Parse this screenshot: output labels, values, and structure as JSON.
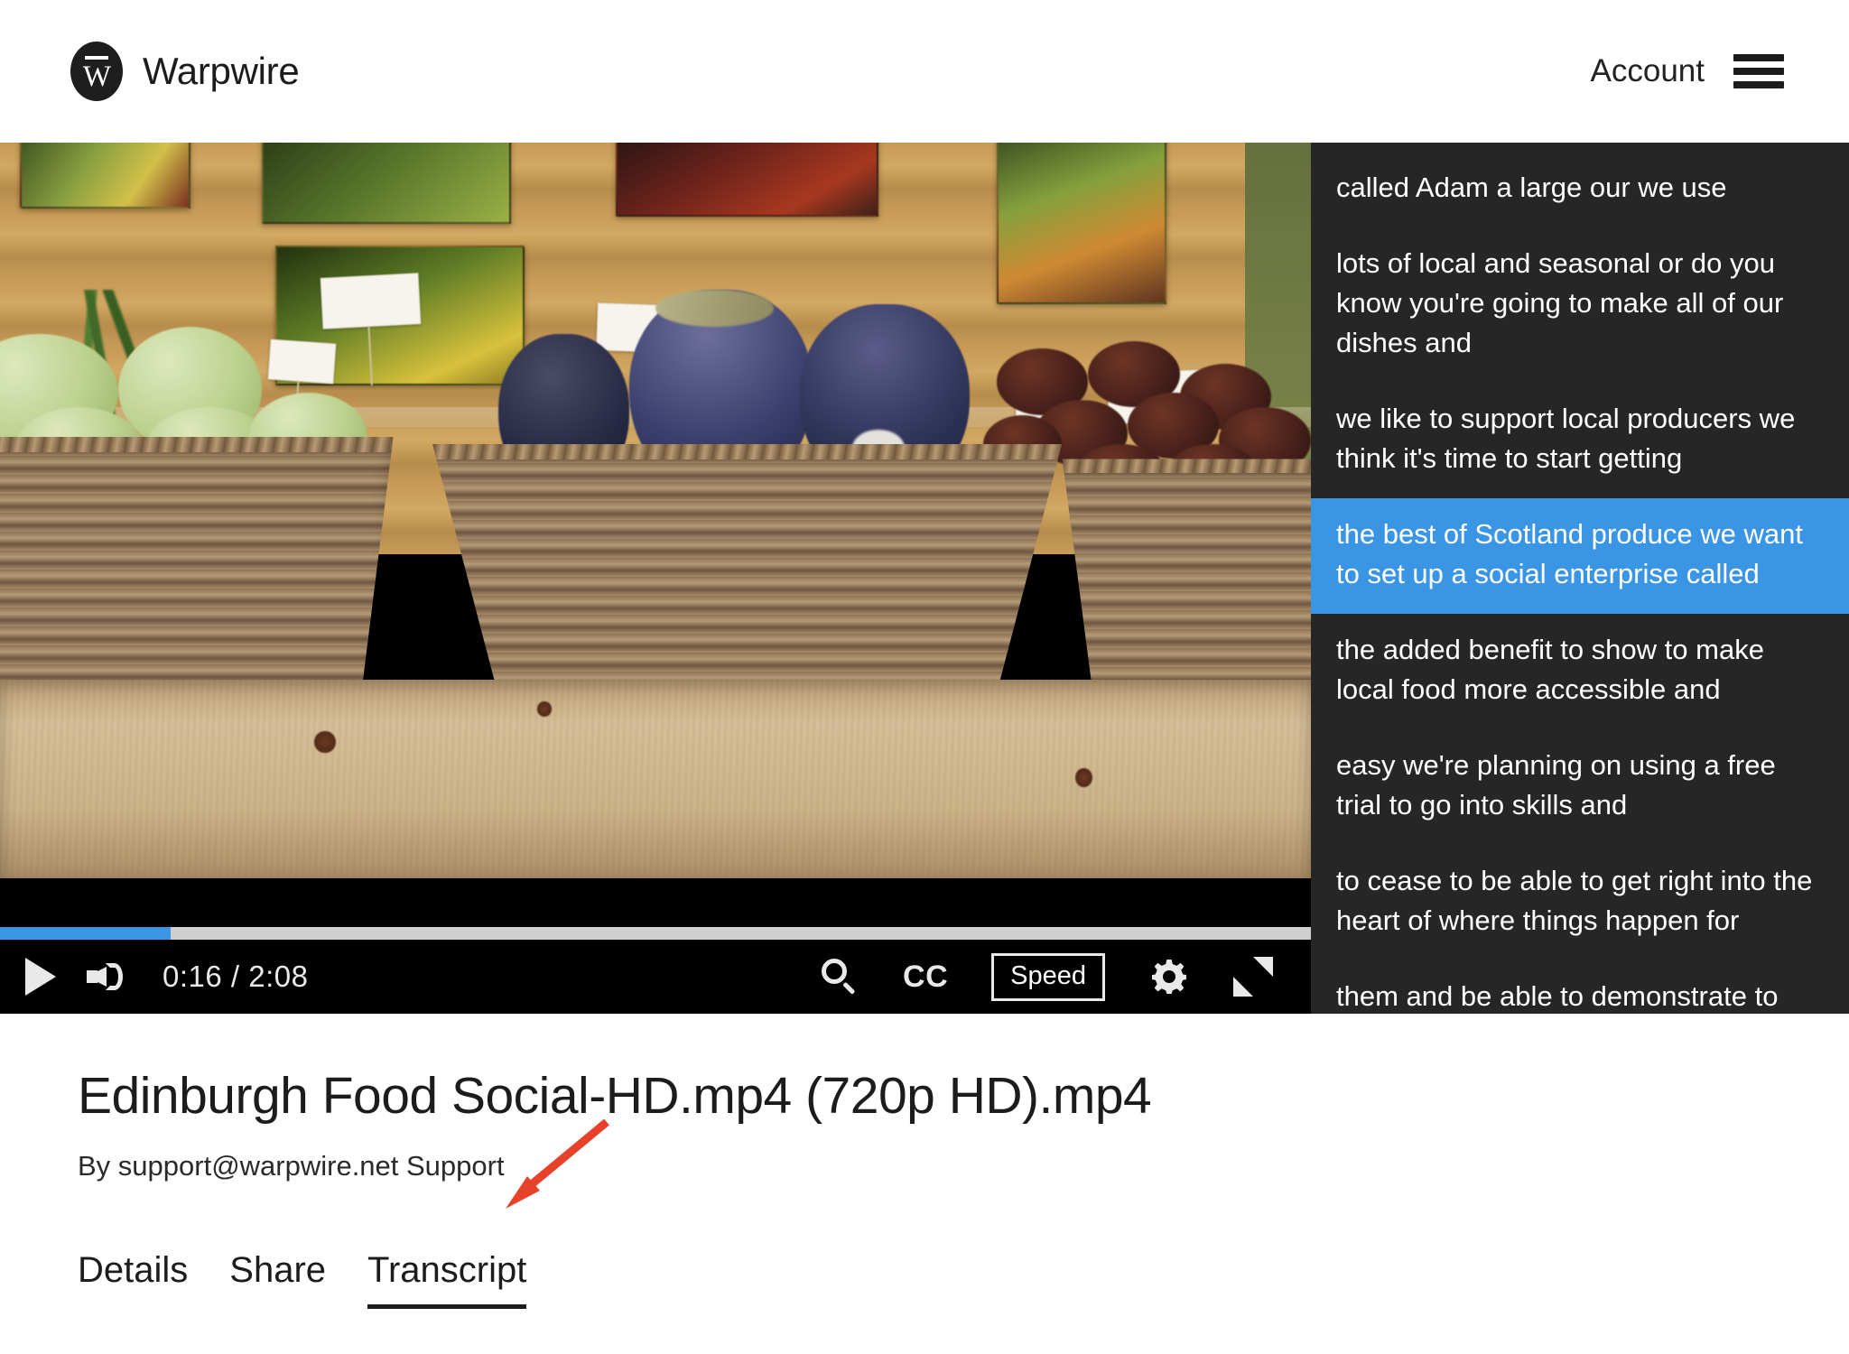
{
  "header": {
    "brand_name": "Warpwire",
    "logo_letter": "W",
    "account_label": "Account",
    "menu_icon": "hamburger-menu-icon"
  },
  "player": {
    "play_icon": "play-icon",
    "volume_icon": "volume-icon",
    "time_display": "0:16 / 2:08",
    "current_time": "0:16",
    "duration": "2:08",
    "progress_percent": 13,
    "progress_fill_color": "#3b95e5",
    "progress_track_color": "#cfcfcf",
    "search_icon": "search-icon",
    "cc_label": "CC",
    "speed_label": "Speed",
    "settings_icon": "gear-icon",
    "fullscreen_icon": "fullscreen-icon",
    "video_background": "#000000"
  },
  "transcript": {
    "panel_background": "#262626",
    "active_background": "#3b95e5",
    "cues": [
      {
        "text": "",
        "active": false,
        "partial": true
      },
      {
        "text": "called Adam a large our we use",
        "active": false,
        "partial": false
      },
      {
        "text": "lots of local and seasonal or do you know you're going to make all of our dishes and",
        "active": false,
        "partial": false
      },
      {
        "text": "we like to support local producers we think it's time to start getting",
        "active": false,
        "partial": false
      },
      {
        "text": "the best of Scotland produce we want to set up a social enterprise called",
        "active": true,
        "partial": false
      },
      {
        "text": "the added benefit to show to make local food more accessible and",
        "active": false,
        "partial": false
      },
      {
        "text": "easy we're planning on using a free trial to go into skills and",
        "active": false,
        "partial": false
      },
      {
        "text": "to cease to be able to get right into the heart of where things happen for",
        "active": false,
        "partial": false
      },
      {
        "text": "them and be able to demonstrate to them what they can do you with all the help we",
        "active": false,
        "partial": false
      }
    ]
  },
  "media_info": {
    "title": "Edinburgh Food Social-HD.mp4 (720p HD).mp4",
    "byline": "By support@warpwire.net Support"
  },
  "tabs": [
    {
      "label": "Details",
      "active": false
    },
    {
      "label": "Share",
      "active": false
    },
    {
      "label": "Transcript",
      "active": true
    }
  ],
  "annotation": {
    "arrow_color": "#e8412a",
    "points_to": "Transcript"
  }
}
